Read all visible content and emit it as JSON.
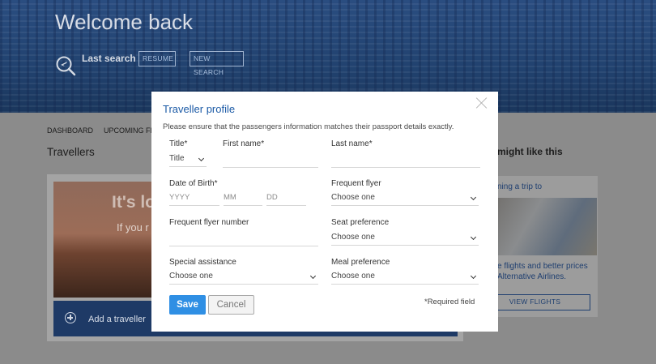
{
  "hero": {
    "title": "Welcome back",
    "last_search_label": "Last search",
    "resume_label": "RESUME",
    "new_search_label": "NEW SEARCH"
  },
  "nav": {
    "dashboard": "DASHBOARD",
    "upcoming": "UPCOMING FL"
  },
  "travellers_heading": "Travellers",
  "card": {
    "photo_headline": "It's lo",
    "photo_sub": "If you r",
    "add_traveller": "Add a traveller"
  },
  "side": {
    "heading": "might like this",
    "trip": "ning a trip to",
    "line1": "e flights and better prices",
    "line2": "Alternative Airlines.",
    "view_flights": "VIEW FLIGHTS"
  },
  "modal": {
    "title": "Traveller profile",
    "description": "Please ensure that the passengers information matches their passport details exactly.",
    "title_label": "Title*",
    "title_value": "Title",
    "first_name_label": "First name*",
    "first_name_value": "",
    "last_name_label": "Last name*",
    "last_name_value": "",
    "dob_label": "Date of Birth*",
    "dob_year_placeholder": "YYYY",
    "dob_month_placeholder": "MM",
    "dob_day_placeholder": "DD",
    "frequent_flyer_label": "Frequent flyer",
    "frequent_flyer_value": "Choose one",
    "ff_number_label": "Frequent flyer number",
    "ff_number_value": "",
    "seat_label": "Seat preference",
    "seat_value": "Choose one",
    "special_label": "Special assistance",
    "special_value": "Choose one",
    "meal_label": "Meal preference",
    "meal_value": "Choose one",
    "save_label": "Save",
    "cancel_label": "Cancel",
    "required_note": "*Required field"
  },
  "colors": {
    "accent": "#2f8fe4",
    "title_blue": "#1b5aa6",
    "hero_blue": "#21426f"
  }
}
